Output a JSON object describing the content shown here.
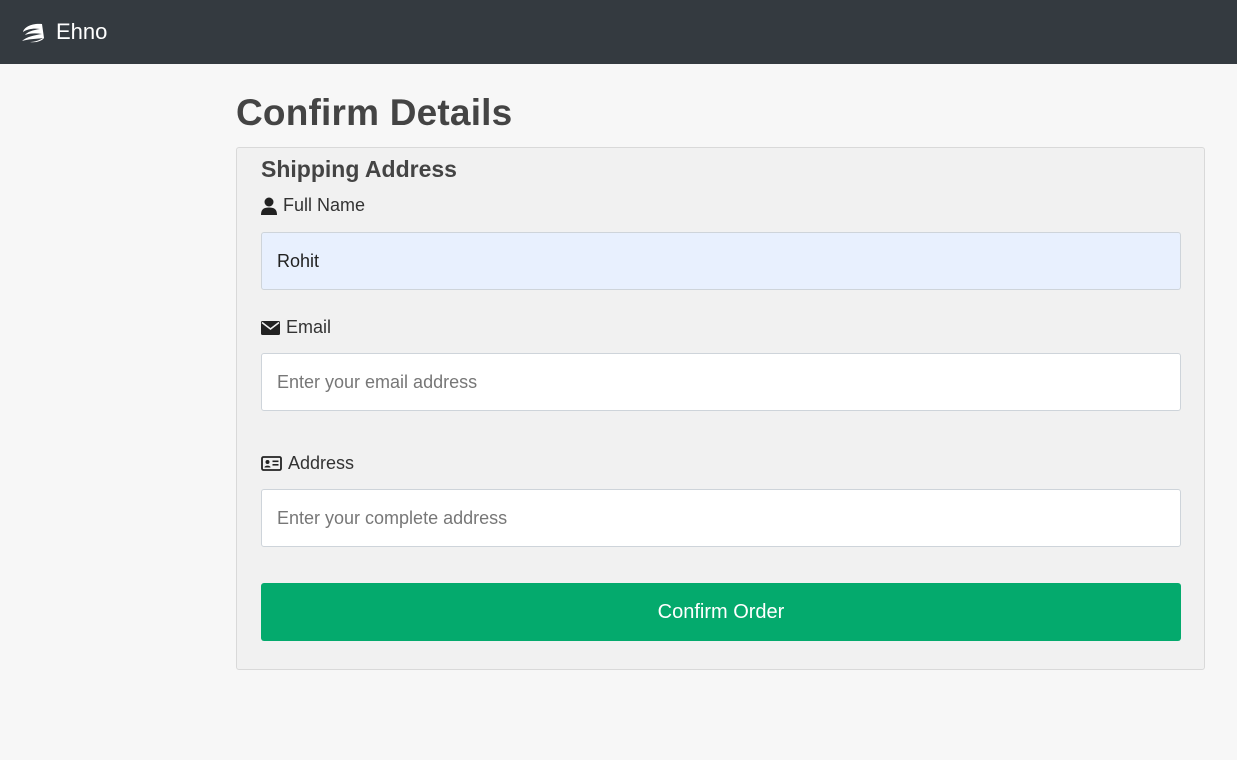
{
  "navbar": {
    "brand_name": "Ehno",
    "brand_icon": "brand-swoosh-icon",
    "background": "#343a40"
  },
  "main": {
    "page_title": "Confirm Details",
    "form": {
      "section_title": "Shipping Address",
      "full_name": {
        "label": "Full Name",
        "icon": "user-icon",
        "value": "Rohit"
      },
      "email": {
        "label": "Email",
        "icon": "envelope-icon",
        "placeholder": "Enter your email address",
        "value": ""
      },
      "address": {
        "label": "Address",
        "icon": "address-card-icon",
        "placeholder": "Enter your complete address",
        "value": ""
      },
      "submit_label": "Confirm Order",
      "submit_color": "#04aa6d"
    }
  }
}
